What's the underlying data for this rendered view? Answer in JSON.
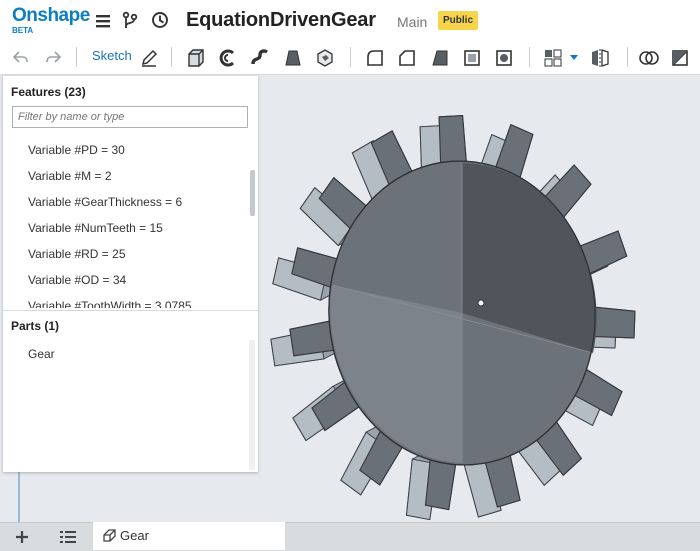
{
  "header": {
    "logo": "Onshape",
    "logo_sub": "BETA",
    "doc_title": "EquationDrivenGear",
    "branch": "Main",
    "badge": "Public",
    "icons": [
      "menu-icon",
      "versions-icon",
      "history-icon"
    ]
  },
  "toolbar": {
    "sketch_label": "Sketch",
    "tools": [
      "undo-icon",
      "redo-icon",
      "sketch-pencil-icon",
      "extrude-icon",
      "revolve-icon",
      "sweep-icon",
      "loft-icon",
      "thicken-icon",
      "fillet-icon",
      "chamfer-icon",
      "draft-icon",
      "shell-icon",
      "hole-icon",
      "pattern-icon",
      "dropdown-icon",
      "mirror-icon",
      "boolean-icon",
      "split-icon"
    ]
  },
  "features_panel": {
    "title": "Features (23)",
    "filter_placeholder": "Filter by name or type",
    "items": [
      "Variable #PD = 30",
      "Variable #M = 2",
      "Variable #GearThickness = 6",
      "Variable #NumTeeth = 15",
      "Variable #RD = 25",
      "Variable #OD = 34",
      "Variable #ToothWidth = 3.0785"
    ]
  },
  "parts_panel": {
    "title": "Parts (1)",
    "items": [
      "Gear"
    ]
  },
  "bottom": {
    "tab_label": "Gear"
  },
  "colors": {
    "brand": "#0d7ec1",
    "badge": "#f6d54a",
    "viewport_bg": "#e6eaef",
    "gear_body": "#5f646b"
  }
}
